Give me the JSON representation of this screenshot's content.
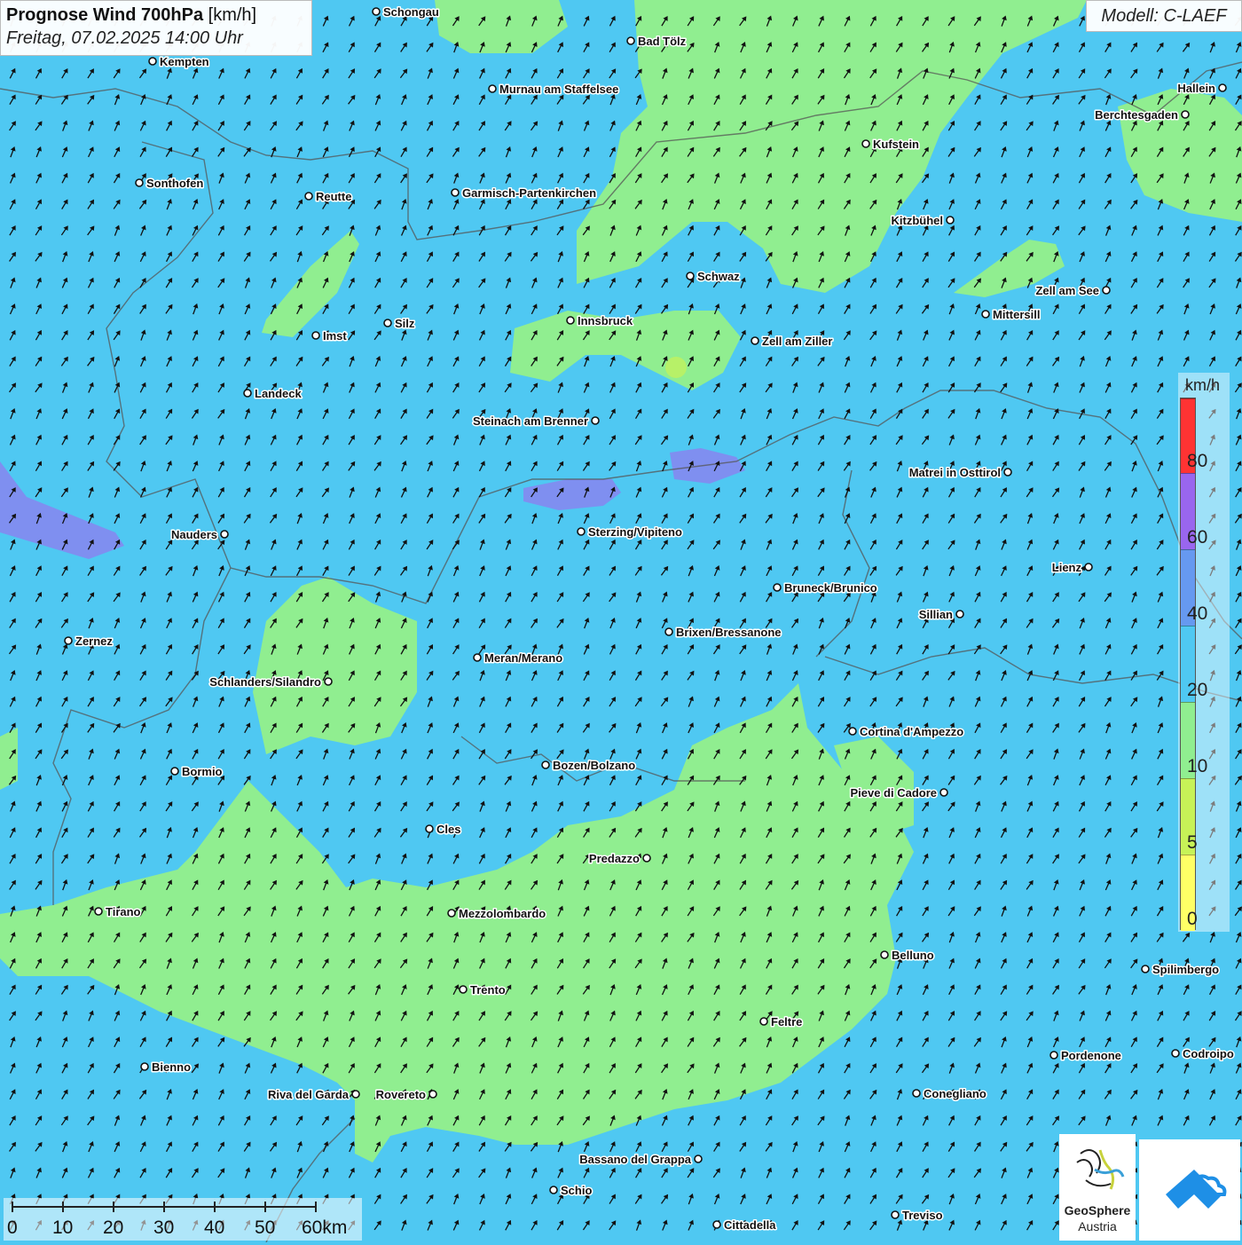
{
  "title": {
    "bold": "Prognose Wind 700hPa",
    "unit": "[km/h]",
    "subtitle": "Freitag, 07.02.2025 14:00 Uhr"
  },
  "model": "Modell: C-LAEF",
  "legend": {
    "unit": "km/h",
    "ticks": [
      "80",
      "60",
      "40",
      "20",
      "10",
      "5",
      "0"
    ],
    "colors": [
      "#ffff66",
      "#c7f257",
      "#90ee90",
      "#4fc8f2",
      "#6699f0",
      "#9966ee",
      "#ff3333",
      "#cfffe8"
    ]
  },
  "scale_bar": {
    "labels": [
      "0",
      "10",
      "20",
      "30",
      "40",
      "50",
      "60km"
    ]
  },
  "logo": {
    "name": "GeoSphere",
    "sub": "Austria"
  },
  "colors": {
    "base_wind": "#4fc8f2",
    "calm_wind": "#90ee90",
    "strong_wind": "#7f8ff0",
    "arrow": "#111111"
  },
  "cities": [
    {
      "name": "Schongau"
    },
    {
      "name": "Bad Tölz"
    },
    {
      "name": "Kempten"
    },
    {
      "name": "Murnau am Staffelsee"
    },
    {
      "name": "Hallein"
    },
    {
      "name": "Berchtesgaden"
    },
    {
      "name": "Kufstein"
    },
    {
      "name": "Sonthofen"
    },
    {
      "name": "Reutte"
    },
    {
      "name": "Garmisch-Partenkirchen"
    },
    {
      "name": "Kitzbühel"
    },
    {
      "name": "Schwaz"
    },
    {
      "name": "Zell am See"
    },
    {
      "name": "Mittersill"
    },
    {
      "name": "Innsbruck"
    },
    {
      "name": "Imst"
    },
    {
      "name": "Silz"
    },
    {
      "name": "Zell am Ziller"
    },
    {
      "name": "Landeck"
    },
    {
      "name": "Steinach am Brenner"
    },
    {
      "name": "Matrei in Osttirol"
    },
    {
      "name": "Nauders"
    },
    {
      "name": "Sterzing/Vipiteno"
    },
    {
      "name": "Lienz"
    },
    {
      "name": "Bruneck/Brunico"
    },
    {
      "name": "Sillian"
    },
    {
      "name": "Brixen/Bressanone"
    },
    {
      "name": "Zernez"
    },
    {
      "name": "Meran/Merano"
    },
    {
      "name": "Schlanders/Silandro"
    },
    {
      "name": "Cortina d'Ampezzo"
    },
    {
      "name": "Bozen/Bolzano"
    },
    {
      "name": "Bormio"
    },
    {
      "name": "Pieve di Cadore"
    },
    {
      "name": "Cles"
    },
    {
      "name": "Predazzo"
    },
    {
      "name": "Tirano"
    },
    {
      "name": "Mezzolombardo"
    },
    {
      "name": "Belluno"
    },
    {
      "name": "Spilimbergo"
    },
    {
      "name": "Trento"
    },
    {
      "name": "Feltre"
    },
    {
      "name": "Bienno"
    },
    {
      "name": "Pordenone"
    },
    {
      "name": "Codroipo"
    },
    {
      "name": "Riva del Garda"
    },
    {
      "name": "Rovereto"
    },
    {
      "name": "Conegliano"
    },
    {
      "name": "Bassano del Grappa"
    },
    {
      "name": "Schio"
    },
    {
      "name": "Treviso"
    },
    {
      "name": "Cittadella"
    }
  ]
}
